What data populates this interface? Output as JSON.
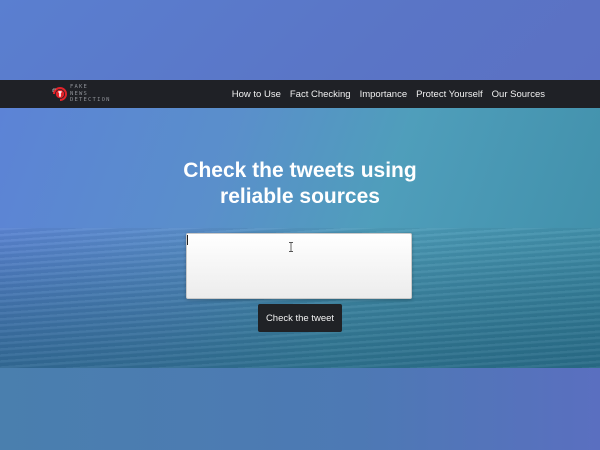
{
  "navbar": {
    "logo_lines": [
      "FAKE",
      "NEWS",
      "DETECTION"
    ],
    "links": [
      {
        "label": "How to Use"
      },
      {
        "label": "Fact Checking"
      },
      {
        "label": "Importance"
      },
      {
        "label": "Protect Yourself"
      },
      {
        "label": "Our Sources"
      }
    ]
  },
  "hero": {
    "headline_line1": "Check the tweets using",
    "headline_line2": "reliable sources",
    "tweet_input": {
      "value": "",
      "placeholder": ""
    },
    "check_button_label": "Check the tweet"
  },
  "colors": {
    "navbar_bg": "#1f2126",
    "button_bg": "#202226",
    "logo_accent": "#e2232a",
    "headline_text": "#ffffff"
  },
  "icons": {
    "logo": "fake-news-detection-logo-icon",
    "cursor": "text-cursor-icon"
  }
}
